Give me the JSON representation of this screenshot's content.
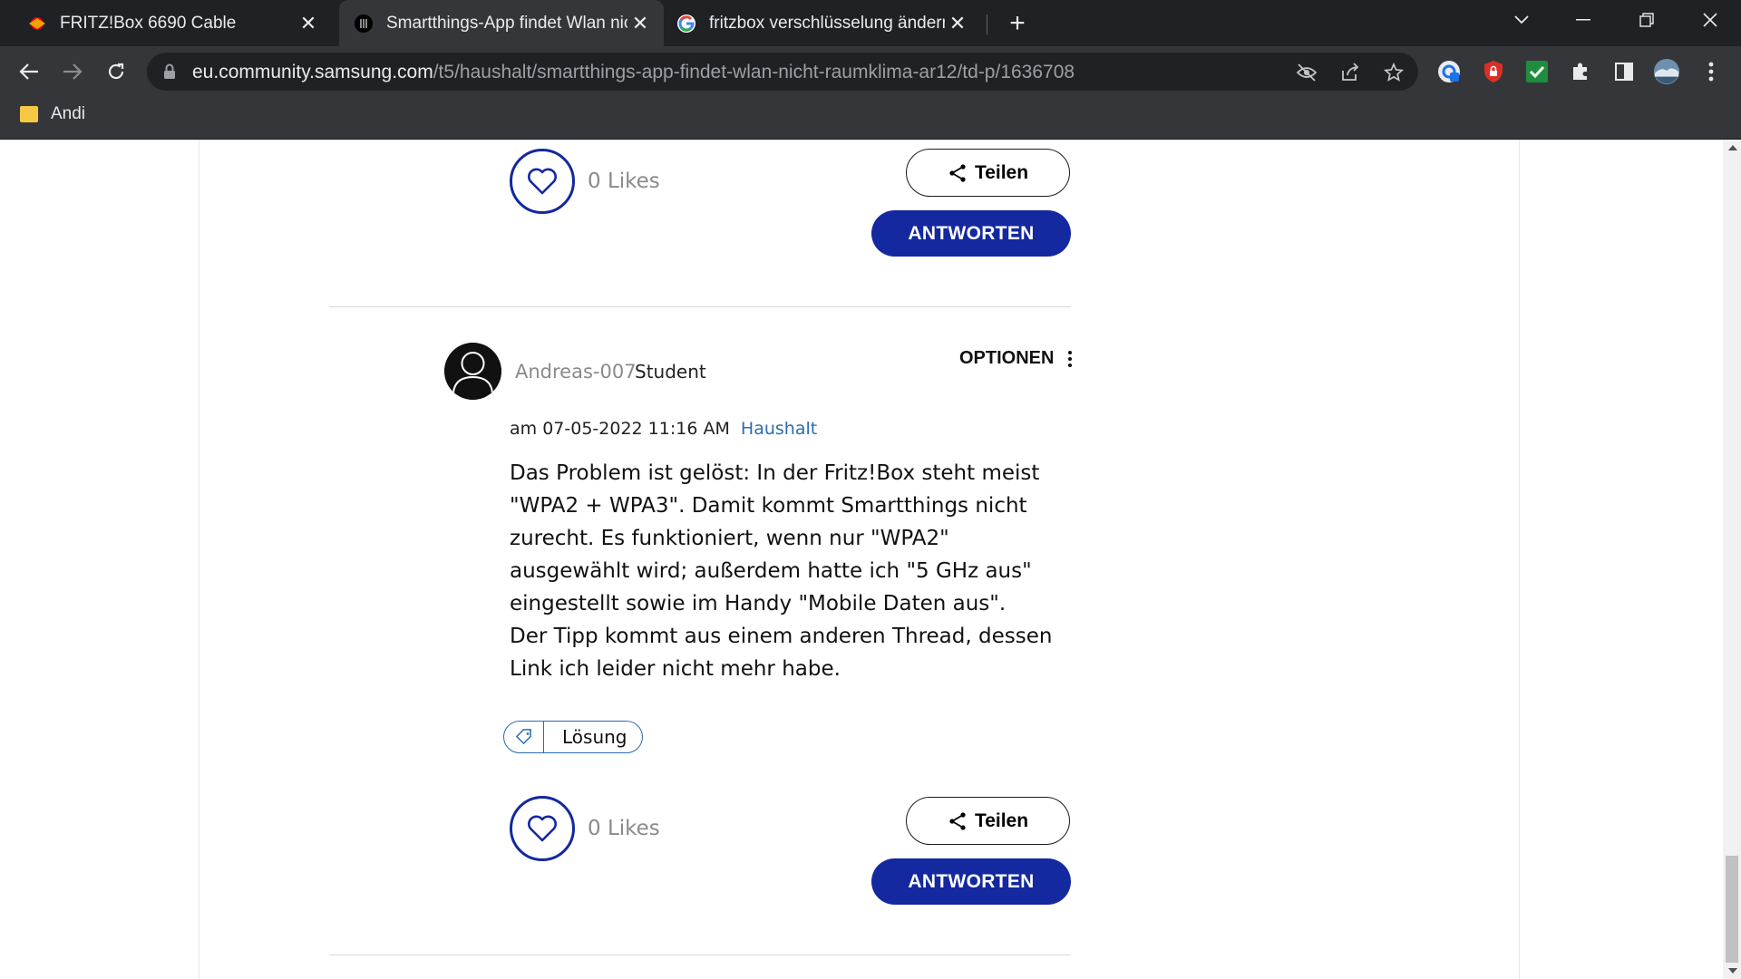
{
  "browser": {
    "tabs": [
      {
        "title": "FRITZ!Box 6690 Cable",
        "favicon": "fritzbox-icon",
        "active": false
      },
      {
        "title": "Smartthings-App findet Wlan nicht",
        "favicon": "samsung-community-icon",
        "active": true
      },
      {
        "title": "fritzbox verschlüsselung ändern - ",
        "favicon": "google-icon",
        "active": false
      }
    ],
    "address": {
      "host": "eu.community.samsung.com",
      "path": "/t5/haushalt/smartthings-app-findet-wlan-nicht-raumklima-ar12/td-p/1636708"
    },
    "bookmarks": [
      {
        "label": "Andi",
        "icon": "folder-icon"
      }
    ]
  },
  "post_top": {
    "likes_label": "0 Likes",
    "share_label": "Teilen",
    "reply_label": "ANTWORTEN"
  },
  "post": {
    "author": "Andreas-007",
    "rank": "Student",
    "options_label": "OPTIONEN",
    "date_prefix": "am",
    "date": "07-05-2022",
    "time": "11:16 AM",
    "board": "Haushalt",
    "body_lines": [
      "Das Problem ist gelöst: In der Fritz!Box steht meist \"WPA2 + WPA3\". Damit kommt Smartthings nicht zurecht. Es funktioniert, wenn nur \"WPA2\" ausgewählt wird; außerdem hatte ich \"5 GHz aus\" eingestellt sowie im Handy \"Mobile Daten aus\".",
      "Der Tipp kommt aus einem anderen Thread, dessen Link ich leider nicht mehr habe."
    ],
    "tag_label": "Lösung",
    "likes_label": "0 Likes",
    "share_label": "Teilen",
    "reply_label": "ANTWORTEN"
  },
  "colors": {
    "accent": "#1428a0",
    "link": "#2b6cb0",
    "chrome_dark": "#202124",
    "chrome_toolbar": "#35363a"
  }
}
